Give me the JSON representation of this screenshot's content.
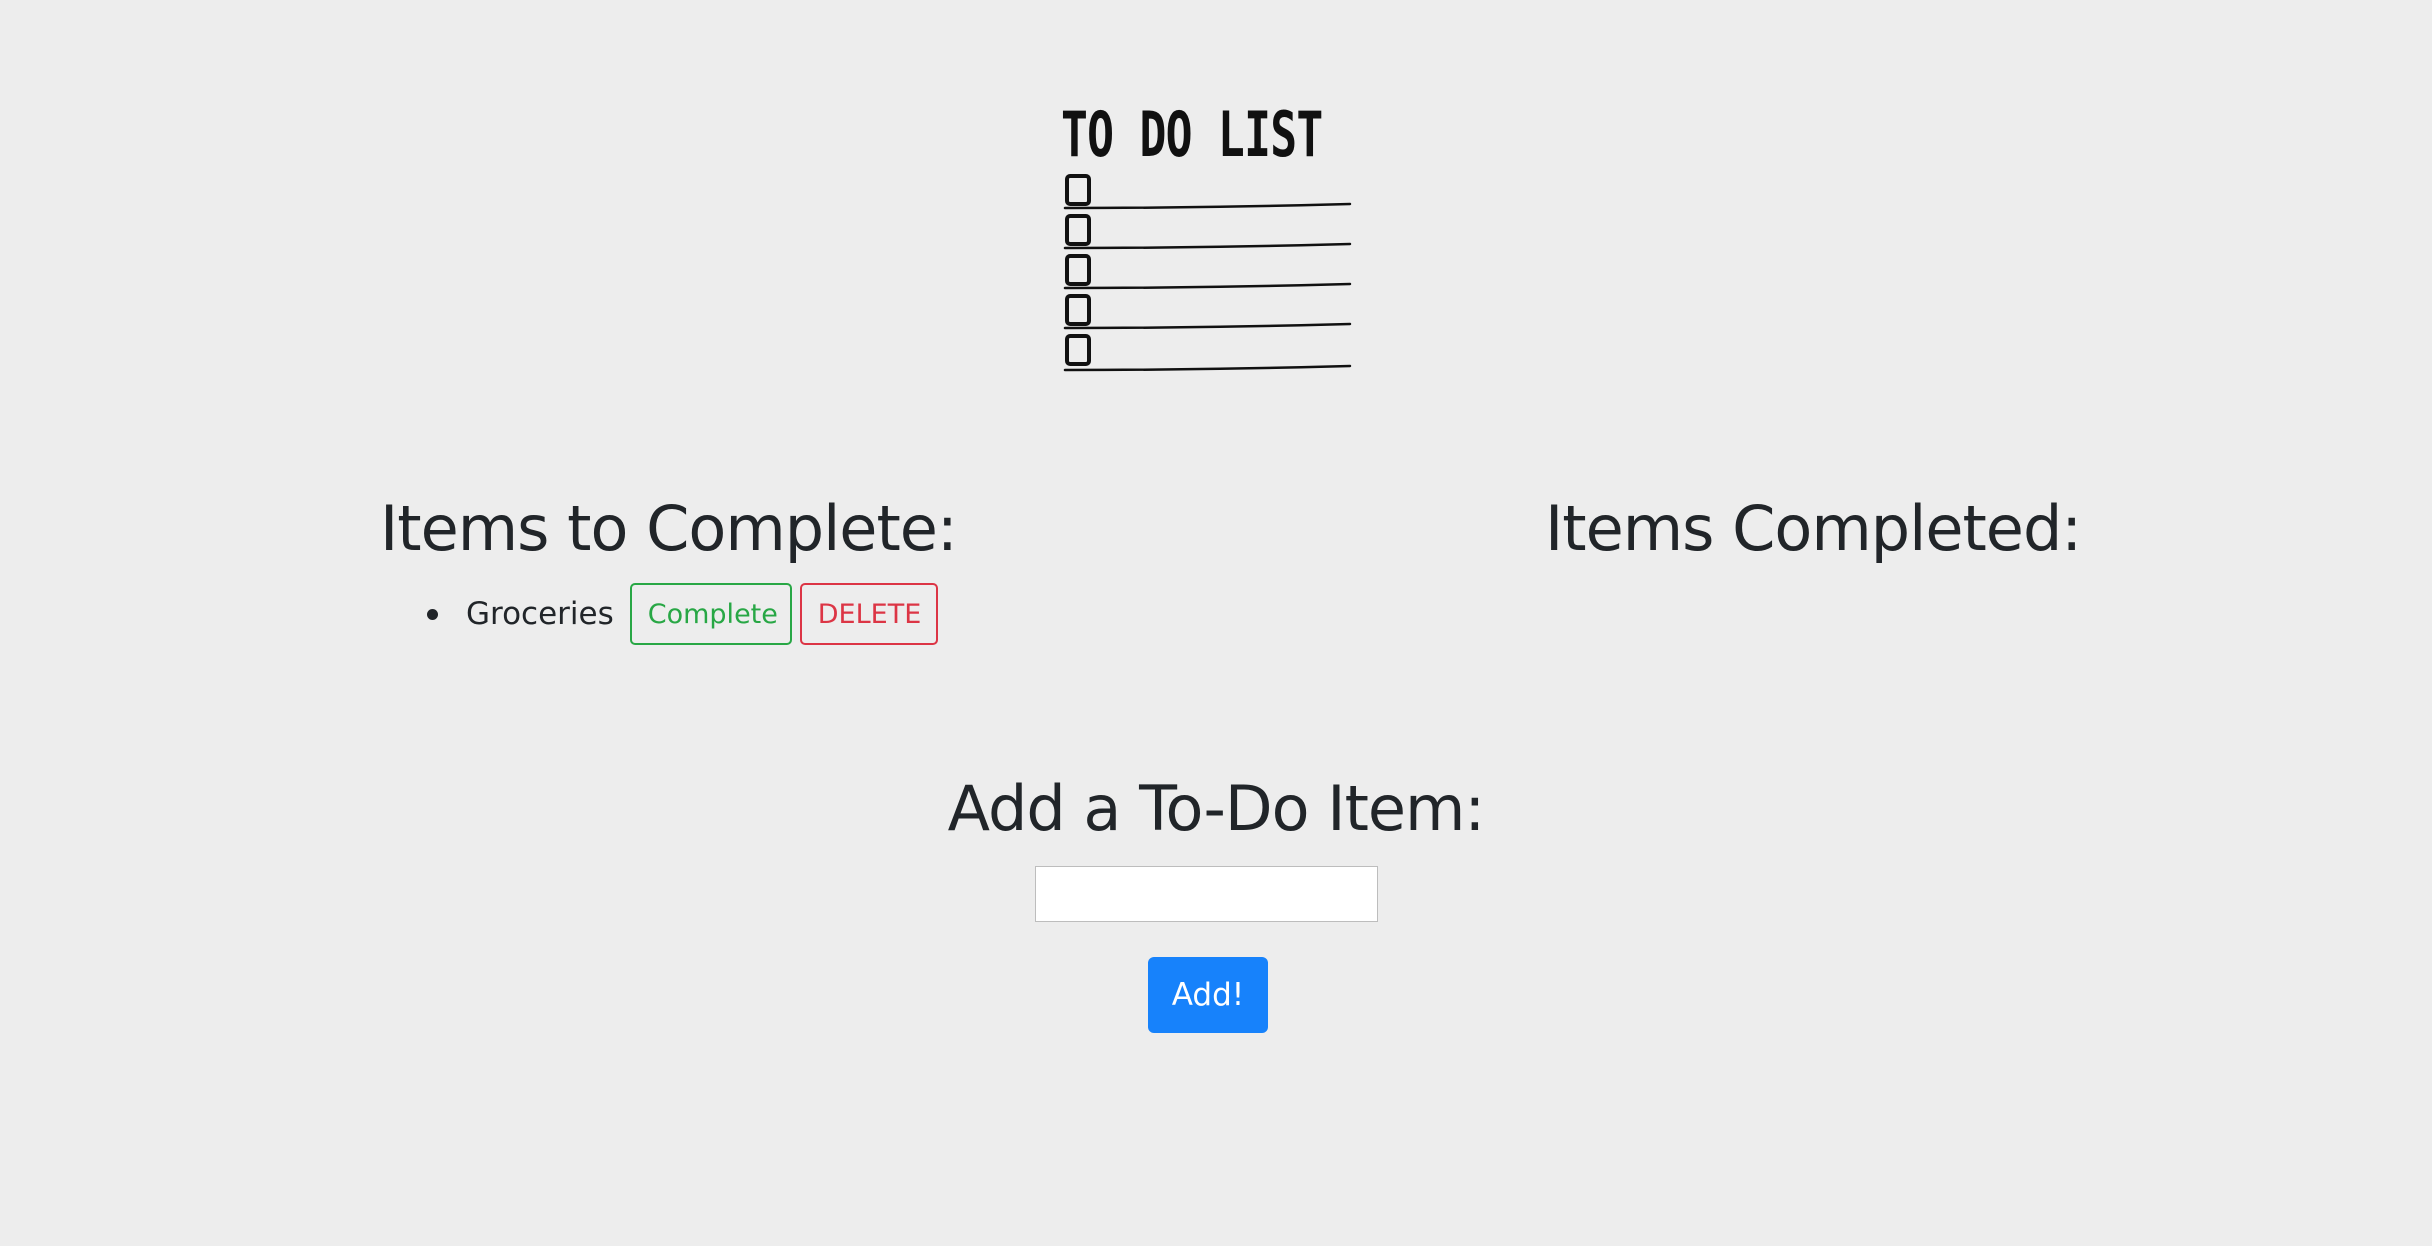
{
  "logo": {
    "title": "TO DO LIST"
  },
  "todo_section": {
    "heading": "Items to Complete:",
    "items": [
      {
        "text": "Groceries",
        "complete_label": "Complete",
        "delete_label": "DELETE"
      }
    ]
  },
  "completed_section": {
    "heading": "Items Completed:"
  },
  "add_section": {
    "heading": "Add a To-Do Item:",
    "input_value": "",
    "button_label": "Add!"
  },
  "colors": {
    "background": "#ededed",
    "complete": "#28a745",
    "delete": "#dc3545",
    "add_button": "#1782fb"
  }
}
